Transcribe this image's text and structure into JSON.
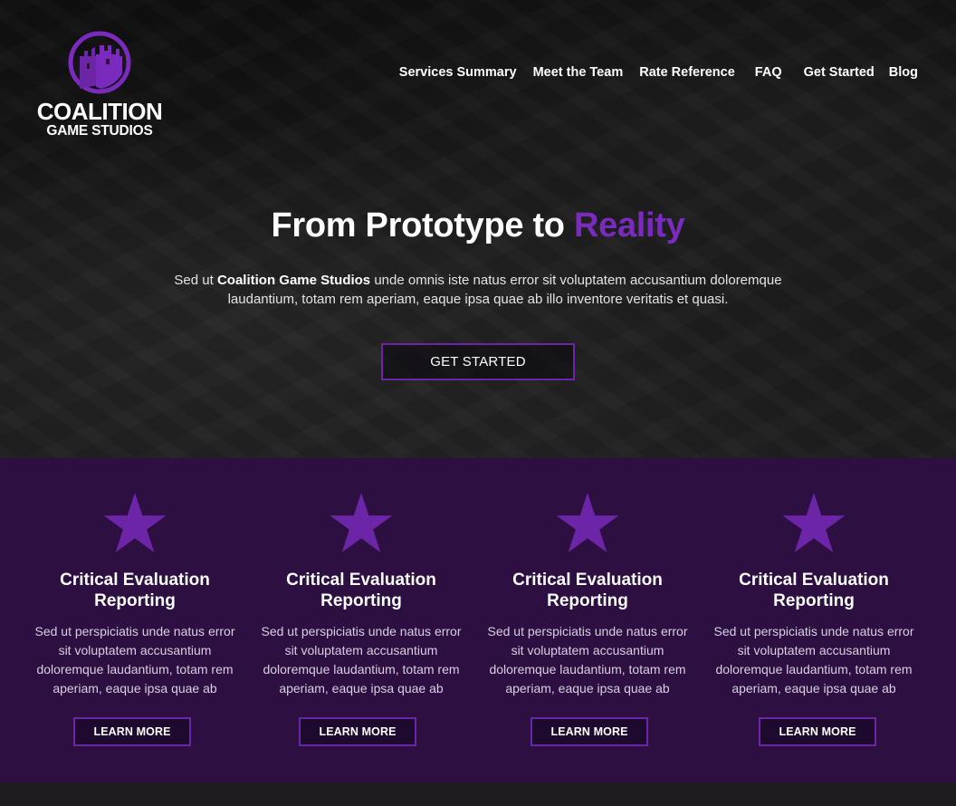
{
  "brand": {
    "name_line1": "COALITION",
    "name_line2": "GAME STUDIOS",
    "accent_color": "#7a2bbd",
    "logo_icon": "castle-emblem-icon"
  },
  "nav": {
    "items": [
      "Services Summary",
      "Meet the Team",
      "Rate Reference",
      "FAQ",
      "Get Started",
      "Blog"
    ]
  },
  "hero": {
    "title_main": "From Prototype to ",
    "title_accent": "Reality",
    "desc_pre": "Sed ut ",
    "desc_bold": "Coalition Game Studios",
    "desc_post": " unde omnis iste natus error sit voluptatem accusantium doloremque laudantium, totam rem aperiam, eaque ipsa quae ab illo inventore veritatis et quasi.",
    "button_label": "GET STARTED"
  },
  "features": {
    "background_color": "#2d0f42",
    "icon": "star-icon",
    "items": [
      {
        "title": "Critical Evaluation Reporting",
        "desc": "Sed ut perspiciatis unde natus error sit voluptatem accusantium doloremque laudantium, totam rem aperiam, eaque ipsa quae ab",
        "button_label": "LEARN MORE"
      },
      {
        "title": "Critical Evaluation Reporting",
        "desc": "Sed ut perspiciatis unde natus error sit voluptatem accusantium doloremque laudantium, totam rem aperiam, eaque ipsa quae ab",
        "button_label": "LEARN MORE"
      },
      {
        "title": "Critical Evaluation Reporting",
        "desc": "Sed ut perspiciatis unde natus error sit voluptatem accusantium doloremque laudantium, totam rem aperiam, eaque ipsa quae ab",
        "button_label": "LEARN MORE"
      },
      {
        "title": "Critical Evaluation Reporting",
        "desc": "Sed ut perspiciatis unde natus error sit voluptatem accusantium doloremque laudantium, totam rem aperiam, eaque ipsa quae ab",
        "button_label": "LEARN MORE"
      }
    ]
  }
}
